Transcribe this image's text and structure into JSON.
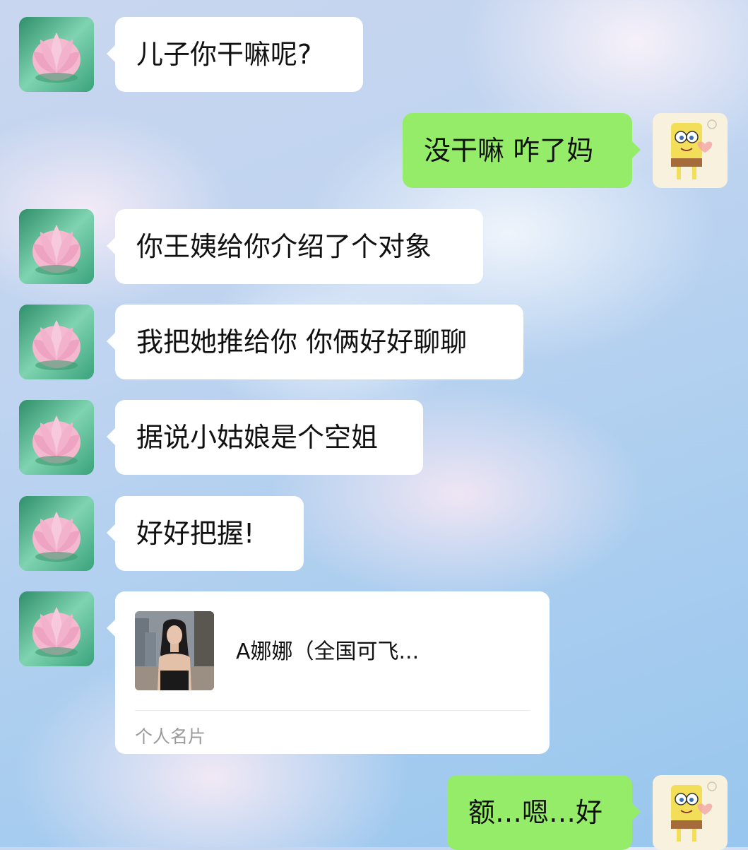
{
  "colors": {
    "incoming_bubble": "#ffffff",
    "outgoing_bubble": "#95ec69",
    "text": "#111111",
    "muted_text": "#9a9a9a"
  },
  "contacts": {
    "mom_avatar_icon": "lotus-flower-avatar-icon",
    "me_avatar_icon": "spongebob-avatar-icon"
  },
  "messages": [
    {
      "sender": "mom",
      "text": "儿子你干嘛呢?"
    },
    {
      "sender": "me",
      "text": "没干嘛 咋了妈"
    },
    {
      "sender": "mom",
      "text": "你王姨给你介绍了个对象"
    },
    {
      "sender": "mom",
      "text": "我把她推给你 你俩好好聊聊"
    },
    {
      "sender": "mom",
      "text": "据说小姑娘是个空姐"
    },
    {
      "sender": "mom",
      "text": "好好把握!"
    },
    {
      "sender": "mom",
      "type": "contact_card",
      "card_name": "A娜娜（全国可飞...",
      "card_type": "个人名片"
    },
    {
      "sender": "me",
      "text": "额…嗯…好"
    }
  ]
}
